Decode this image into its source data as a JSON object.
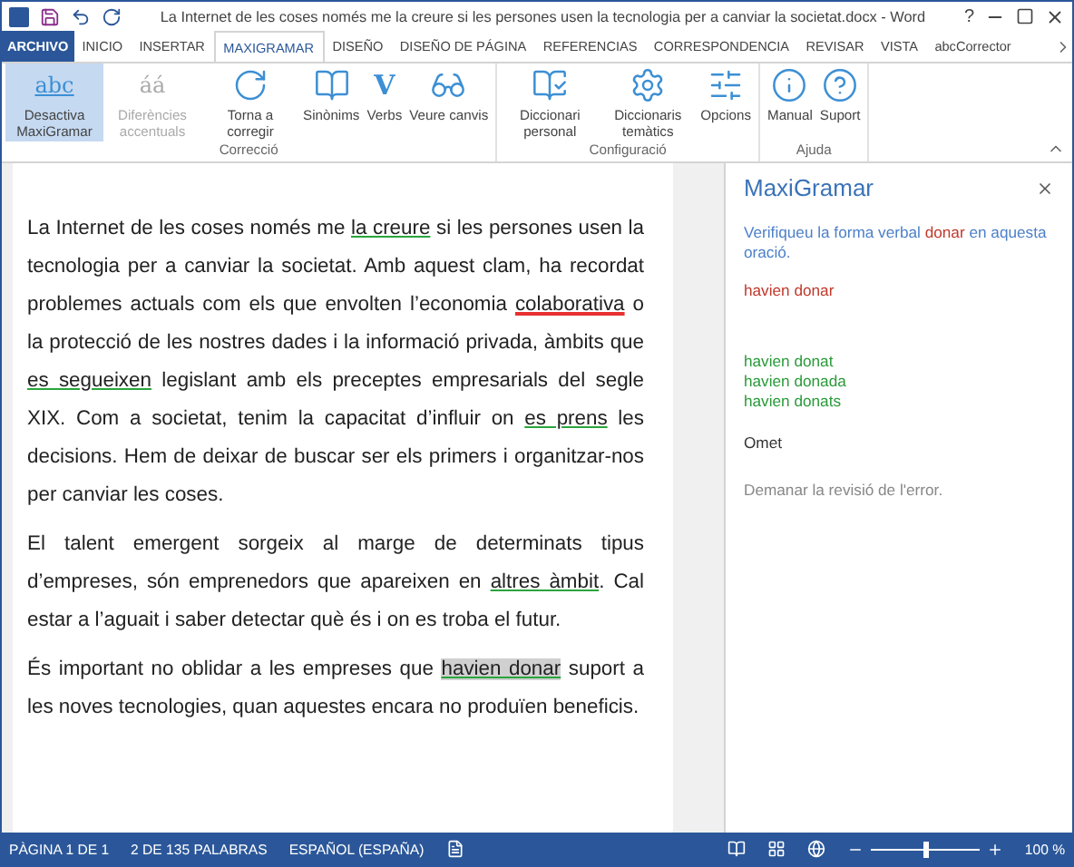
{
  "window": {
    "title": "La Internet de les coses només me la creure si les persones usen la tecnologia per a canviar la societat.docx - Word",
    "help": "?"
  },
  "tabs": [
    {
      "label": "ARCHIVO",
      "kind": "file",
      "selected": false
    },
    {
      "label": "INICIO",
      "kind": "tab",
      "selected": false
    },
    {
      "label": "INSERTAR",
      "kind": "tab",
      "selected": false
    },
    {
      "label": "MAXIGRAMAR",
      "kind": "tab",
      "selected": true
    },
    {
      "label": "DISEÑO",
      "kind": "tab",
      "selected": false
    },
    {
      "label": "DISEÑO DE PÁGINA",
      "kind": "tab",
      "selected": false
    },
    {
      "label": "REFERENCIAS",
      "kind": "tab",
      "selected": false
    },
    {
      "label": "CORRESPONDENCIA",
      "kind": "tab",
      "selected": false
    },
    {
      "label": "REVISAR",
      "kind": "tab",
      "selected": false
    },
    {
      "label": "VISTA",
      "kind": "tab",
      "selected": false
    },
    {
      "label": "abcCorrector",
      "kind": "tab",
      "selected": false
    }
  ],
  "ribbon": [
    {
      "group": "Correcció",
      "buttons": [
        {
          "label": "Desactiva MaxiGramar",
          "glyph": "abc",
          "selected": true,
          "disabled": false
        },
        {
          "label": "Diferències accentuals",
          "glyph": "áá",
          "selected": false,
          "disabled": true
        },
        {
          "label": "Torna a corregir",
          "selected": false,
          "disabled": false
        },
        {
          "label": "Sinònims",
          "selected": false,
          "disabled": false
        },
        {
          "label": "Verbs",
          "glyph": "V",
          "selected": false,
          "disabled": false
        },
        {
          "label": "Veure canvis",
          "selected": false,
          "disabled": false
        }
      ]
    },
    {
      "group": "Configuració",
      "buttons": [
        {
          "label": "Diccionari personal",
          "selected": false,
          "disabled": false
        },
        {
          "label": "Diccionaris temàtics",
          "selected": false,
          "disabled": false
        },
        {
          "label": "Opcions",
          "selected": false,
          "disabled": false
        }
      ]
    },
    {
      "group": "Ajuda",
      "buttons": [
        {
          "label": "Manual",
          "selected": false,
          "disabled": false
        },
        {
          "label": "Suport",
          "selected": false,
          "disabled": false
        }
      ]
    }
  ],
  "document": {
    "paragraphs": [
      {
        "runs": [
          {
            "text": "La Internet de les coses només me ",
            "kind": "plain"
          },
          {
            "text": "la creure",
            "kind": "grammar"
          },
          {
            "text": " si les persones usen la tecnologia per a canviar la societat. Amb aquest clam, ha recordat problemes actuals com els que envolten l’economia ",
            "kind": "plain"
          },
          {
            "text": "colaborativa",
            "kind": "spelling"
          },
          {
            "text": " o la protecció de les nostres dades i la informació privada, àmbits que ",
            "kind": "plain"
          },
          {
            "text": "es segueixen",
            "kind": "grammar"
          },
          {
            "text": " legislant amb els preceptes empresarials del segle XIX. Com a societat, tenim la capacitat d’influir on ",
            "kind": "plain"
          },
          {
            "text": "es prens",
            "kind": "grammar"
          },
          {
            "text": " les decisions. Hem de deixar de buscar ser els primers  i organitzar-nos per canviar les coses.",
            "kind": "plain"
          }
        ]
      },
      {
        "runs": [
          {
            "text": "El talent emergent sorgeix al marge de determinats tipus d’empreses, són emprenedors que apareixen en ",
            "kind": "plain"
          },
          {
            "text": "altres àmbit",
            "kind": "grammar"
          },
          {
            "text": ". Cal estar a l’aguait i saber detectar què és i on es troba el futur.",
            "kind": "plain"
          }
        ]
      },
      {
        "runs": [
          {
            "text": "És important no oblidar a les empreses que ",
            "kind": "plain"
          },
          {
            "text": "havien donar",
            "kind": "current"
          },
          {
            "text": " suport a les noves tecnologies, quan aquestes encara no  produïen beneficis.",
            "kind": "plain"
          }
        ]
      }
    ]
  },
  "pane": {
    "title": "MaxiGramar",
    "message": [
      {
        "text": "Verifiqueu la forma verbal ",
        "kind": "plain"
      },
      {
        "text": "donar",
        "kind": "error"
      },
      {
        "text": " en aquesta oració.",
        "kind": "plain"
      }
    ],
    "error": "havien donar",
    "suggestions": [
      "havien donat",
      "havien donada",
      "havien donats"
    ],
    "ignore": "Omet",
    "report": "Demanar la revisió de l'error."
  },
  "status_bar": {
    "page": "PÀGINA 1 DE 1",
    "words": "2 DE 135 PALABRAS",
    "language": "ESPAÑOL (ESPAÑA)",
    "zoom": {
      "level": 0.5,
      "reading": "100 %"
    }
  }
}
